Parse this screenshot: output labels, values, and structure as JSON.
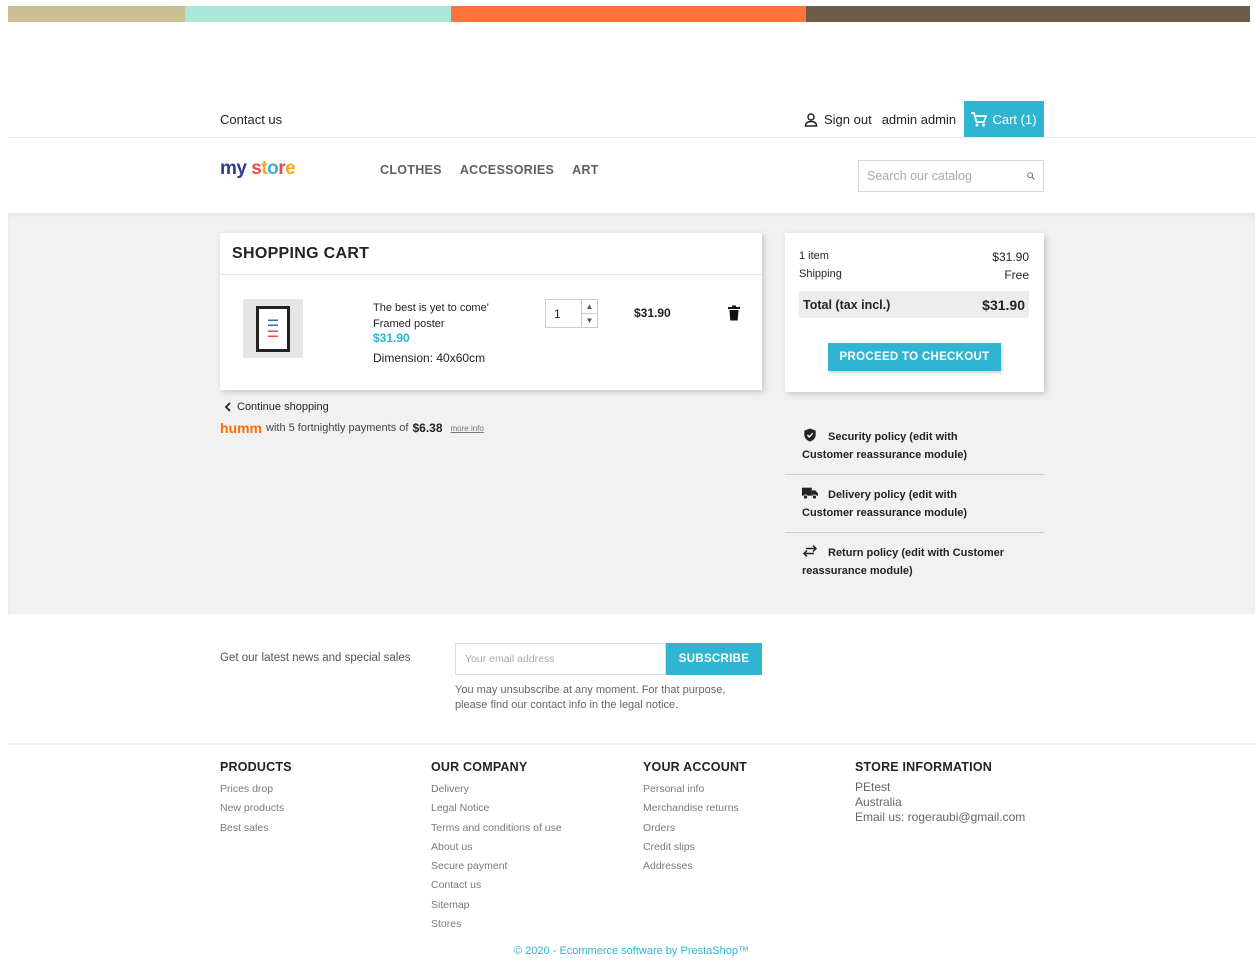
{
  "colors": {
    "accent": "#2fb5d2",
    "bar": [
      "#ccbf94",
      "#a9e7d9",
      "#ff7439",
      "#6c5b45"
    ]
  },
  "topnav": {
    "contact": "Contact us",
    "signout": "Sign out",
    "username": "admin admin",
    "cart": "Cart (1)"
  },
  "header": {
    "logo_my": "my",
    "logo_store": [
      "s",
      "t",
      "o",
      "r",
      "e"
    ],
    "menu": [
      "CLOTHES",
      "ACCESSORIES",
      "ART"
    ],
    "search_placeholder": "Search our catalog"
  },
  "cart": {
    "title": "SHOPPING CART",
    "item": {
      "name_line1": "The best is yet to come'",
      "name_line2": "Framed poster",
      "price": "$31.90",
      "dimension_label": "Dimension:",
      "dimension_value": "40x60cm",
      "quantity": "1",
      "line_total": "$31.90"
    },
    "continue": "Continue shopping"
  },
  "humm": {
    "logo": "humm",
    "text": "with 5 fortnightly payments of",
    "amount": "$6.38",
    "more": "more info"
  },
  "summary": {
    "items_label": "1 item",
    "items_value": "$31.90",
    "shipping_label": "Shipping",
    "shipping_value": "Free",
    "total_label": "Total (tax incl.)",
    "total_value": "$31.90",
    "checkout": "PROCEED TO CHECKOUT"
  },
  "reassurance": [
    {
      "line1": "Security policy (edit with",
      "line2": "Customer reassurance module)"
    },
    {
      "line1": "Delivery policy (edit with",
      "line2": "Customer reassurance module)"
    },
    {
      "line1": "Return policy (edit with Customer",
      "line2": "reassurance module)"
    }
  ],
  "newsletter": {
    "label": "Get our latest news and special sales",
    "placeholder": "Your email address",
    "button": "SUBSCRIBE",
    "note_line1": "You may unsubscribe at any moment. For that purpose,",
    "note_line2": "please find our contact info in the legal notice."
  },
  "footer": {
    "products": {
      "title": "PRODUCTS",
      "links": [
        "Prices drop",
        "New products",
        "Best sales"
      ]
    },
    "company": {
      "title": "OUR COMPANY",
      "links": [
        "Delivery",
        "Legal Notice",
        "Terms and conditions of use",
        "About us",
        "Secure payment",
        "Contact us",
        "Sitemap",
        "Stores"
      ]
    },
    "account": {
      "title": "YOUR ACCOUNT",
      "links": [
        "Personal info",
        "Merchandise returns",
        "Orders",
        "Credit slips",
        "Addresses"
      ]
    },
    "store": {
      "title": "STORE INFORMATION",
      "lines": [
        "PEtest",
        "Australia",
        "Email us: rogeraubi@gmail.com"
      ]
    },
    "copyright": "© 2020 - Ecommerce software by PrestaShop™"
  }
}
